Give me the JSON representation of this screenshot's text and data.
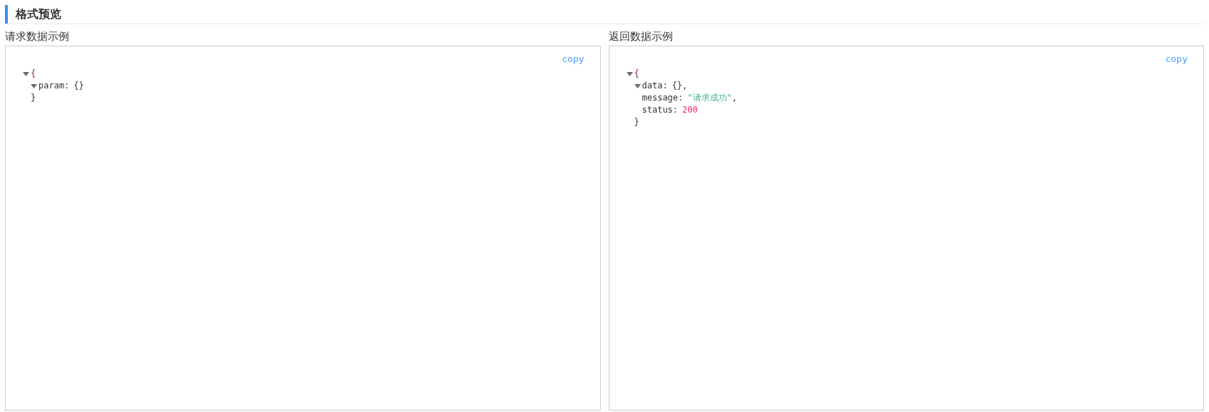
{
  "title": "格式预览",
  "panels": [
    {
      "label": "请求数据示例",
      "copy": "copy",
      "root": {
        "open": "{",
        "close": "}",
        "expanded": true,
        "entries": [
          {
            "key": "param:",
            "value": "{}",
            "kind": "object",
            "expanded": true
          }
        ]
      }
    },
    {
      "label": "返回数据示例",
      "copy": "copy",
      "root": {
        "open": "{",
        "close": "}",
        "expanded": true,
        "entries": [
          {
            "key": "data:",
            "value": "{}",
            "kind": "object",
            "expanded": true,
            "punct": ","
          },
          {
            "key": "message:",
            "value": "\"请求成功\"",
            "kind": "string",
            "punct": ","
          },
          {
            "key": "status:",
            "value": "200",
            "kind": "number"
          }
        ]
      }
    }
  ]
}
